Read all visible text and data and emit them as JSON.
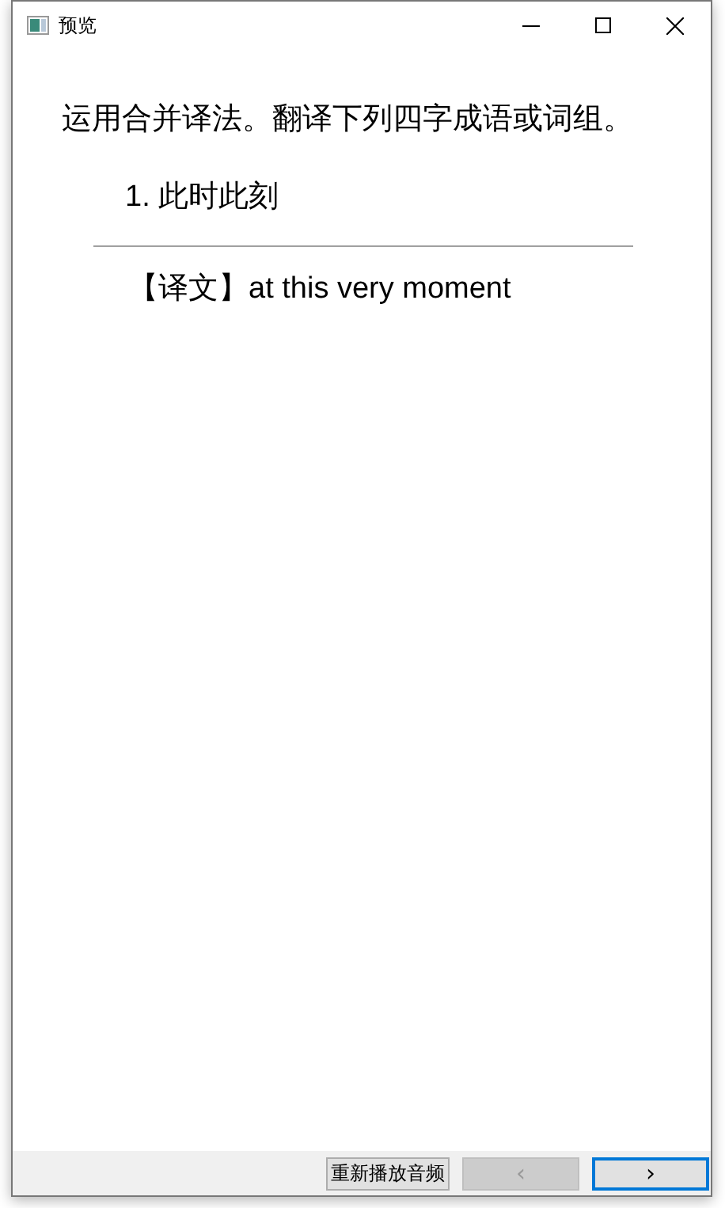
{
  "window": {
    "title": "预览"
  },
  "instruction": "运用合并译法。翻译下列四字成语或词组。",
  "question": "1. 此时此刻",
  "answer": {
    "label": "【译文】",
    "text": "at this very moment"
  },
  "buttons": [
    {
      "kind": "text",
      "label": "重新播放音频",
      "disabled": false,
      "focused": false
    },
    {
      "kind": "nav",
      "label": "‹",
      "disabled": true,
      "focused": false
    },
    {
      "kind": "nav",
      "label": "›",
      "disabled": false,
      "focused": true
    }
  ]
}
